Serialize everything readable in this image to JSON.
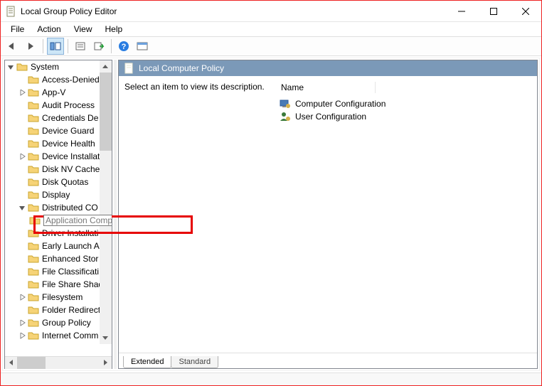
{
  "title": "Local Group Policy Editor",
  "menus": {
    "file": "File",
    "action": "Action",
    "view": "View",
    "help": "Help"
  },
  "right": {
    "header": "Local Computer Policy",
    "description_prompt": "Select an item to view its description.",
    "column_name": "Name",
    "items": {
      "comp": "Computer Configuration",
      "user": "User Configuration"
    }
  },
  "tabs": {
    "extended": "Extended",
    "standard": "Standard"
  },
  "tree": {
    "root": "System",
    "editing_value": "Application Compatibility Settings",
    "items": {
      "access": "Access-Denied",
      "appv": "App-V",
      "audit": "Audit Process",
      "cred": "Credentials De",
      "dguard": "Device Guard",
      "dhealth": "Device Health",
      "dinstall": "Device Installat",
      "disknv": "Disk NV Cache",
      "diskq": "Disk Quotas",
      "display": "Display",
      "dcom": "Distributed CO",
      "driver": "Driver Installati",
      "ela": "Early Launch A",
      "estor": "Enhanced Stor",
      "fclass": "File Classificati",
      "fshare": "File Share Shad",
      "fsys": "Filesystem",
      "fredir": "Folder Redirect",
      "gpol": "Group Policy",
      "inet": "Internet Comm"
    }
  }
}
